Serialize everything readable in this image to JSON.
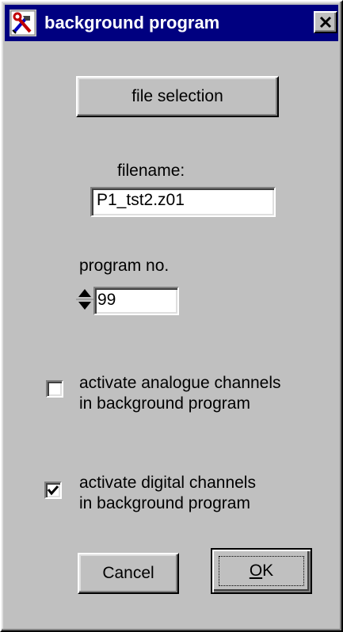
{
  "window": {
    "title": "background program",
    "app_icon": "hammer-wrench-icon",
    "close_icon": "close-icon"
  },
  "file_selection_label": "file selection",
  "filename": {
    "label": "filename:",
    "value": "P1_tst2.z01"
  },
  "program": {
    "label": "program no.",
    "value": "99",
    "spinner_icon": "spin-up-down-icon"
  },
  "analogue": {
    "line1": "activate analogue channels",
    "line2": "in background program",
    "checked": false
  },
  "digital": {
    "line1": "activate digital channels",
    "line2": "in background program",
    "checked": true
  },
  "buttons": {
    "cancel": "Cancel",
    "ok_mnemonic": "O",
    "ok_rest": "K"
  }
}
